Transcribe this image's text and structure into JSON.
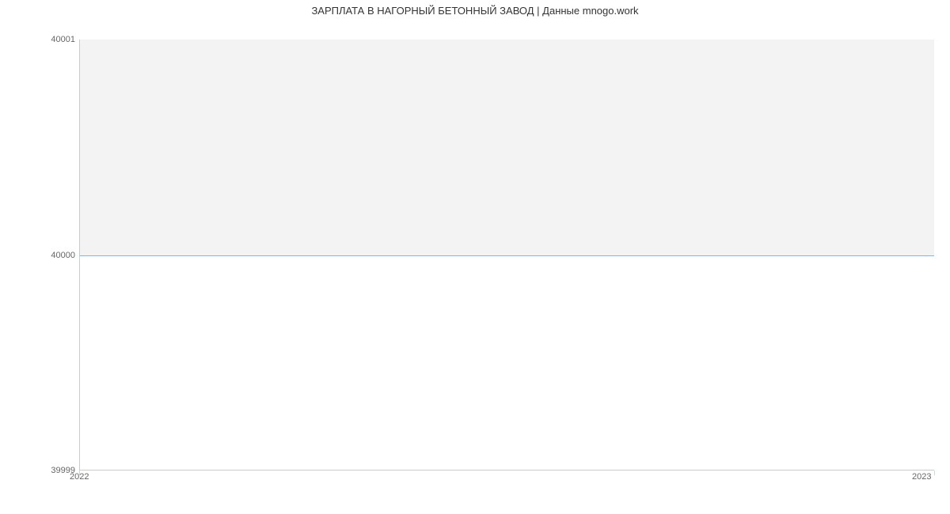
{
  "chart_data": {
    "type": "line",
    "title": "ЗАРПЛАТА В  НАГОРНЫЙ БЕТОННЫЙ ЗАВОД | Данные mnogo.work",
    "xlabel": "",
    "ylabel": "",
    "x": [
      "2022",
      "2023"
    ],
    "values": [
      40000,
      40000
    ],
    "ylim": [
      39999,
      40001
    ],
    "y_ticks": [
      "39999",
      "40000",
      "40001"
    ],
    "x_ticks": [
      "2022",
      "2023"
    ],
    "line_color": "#7cb5ec"
  }
}
